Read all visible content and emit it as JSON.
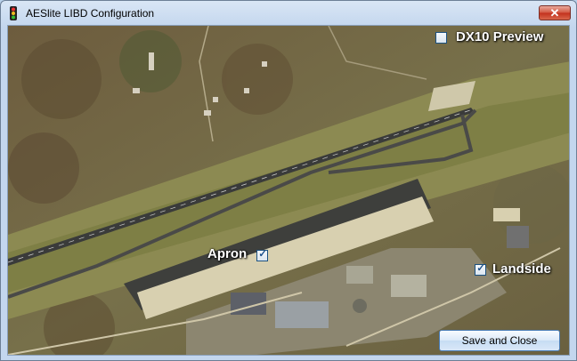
{
  "window": {
    "title": "AESlite LIBD Configuration",
    "close_glyph": "✕"
  },
  "options": {
    "dx10_preview": {
      "label": "DX10 Preview",
      "checked": false
    },
    "apron": {
      "label": "Apron",
      "checked": true
    },
    "landside": {
      "label": "Landside",
      "checked": true
    }
  },
  "buttons": {
    "save_close_label": "Save and Close"
  },
  "icons": {
    "app": "traffic-light-icon",
    "close": "close-icon"
  },
  "colors": {
    "title_bar": "#c3d6ee",
    "close_button": "#c2301c",
    "runway": "#3a3b3a",
    "grass": "#7d7f45",
    "apron": "#d8d0b0"
  }
}
